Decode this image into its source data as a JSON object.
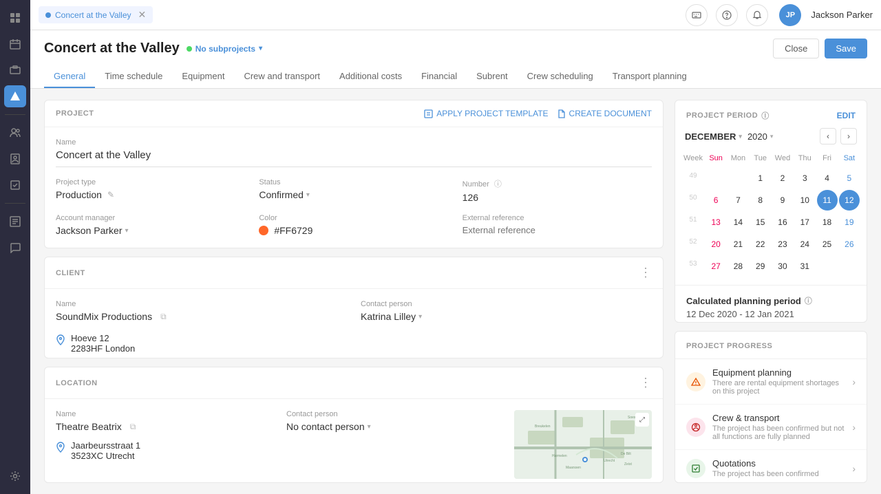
{
  "topbar": {
    "tab_title": "Concert at the Valley",
    "actions": [
      "help-keyboard",
      "help-circle",
      "bell"
    ],
    "avatar_initials": "JP",
    "username": "Jackson Parker"
  },
  "page": {
    "title": "Concert at the Valley",
    "subprojects_label": "No subprojects",
    "btn_close": "Close",
    "btn_save": "Save"
  },
  "tabs": [
    {
      "id": "general",
      "label": "General",
      "active": true
    },
    {
      "id": "time-schedule",
      "label": "Time schedule",
      "active": false
    },
    {
      "id": "equipment",
      "label": "Equipment",
      "active": false
    },
    {
      "id": "crew-transport",
      "label": "Crew and transport",
      "active": false
    },
    {
      "id": "additional-costs",
      "label": "Additional costs",
      "active": false
    },
    {
      "id": "financial",
      "label": "Financial",
      "active": false
    },
    {
      "id": "subrent",
      "label": "Subrent",
      "active": false
    },
    {
      "id": "crew-scheduling",
      "label": "Crew scheduling",
      "active": false
    },
    {
      "id": "transport-planning",
      "label": "Transport planning",
      "active": false
    }
  ],
  "project_card": {
    "section_title": "PROJECT",
    "apply_template_label": "APPLY PROJECT TEMPLATE",
    "create_doc_label": "CREATE DOCUMENT",
    "name_label": "Name",
    "name_value": "Concert at the Valley",
    "project_type_label": "Project type",
    "project_type_value": "Production",
    "status_label": "Status",
    "status_value": "Confirmed",
    "number_label": "Number",
    "number_value": "126",
    "account_manager_label": "Account manager",
    "account_manager_value": "Jackson Parker",
    "color_label": "Color",
    "color_value": "#FF6729",
    "external_ref_label": "External reference",
    "external_ref_placeholder": "External reference"
  },
  "client_card": {
    "section_title": "CLIENT",
    "name_label": "Name",
    "name_value": "SoundMix Productions",
    "contact_label": "Contact person",
    "contact_value": "Katrina Lilley",
    "address_line1": "Hoeve 12",
    "address_line2": "2283HF London"
  },
  "location_card": {
    "section_title": "LOCATION",
    "name_label": "Name",
    "name_value": "Theatre Beatrix",
    "contact_label": "Contact person",
    "contact_value": "No contact person",
    "address_line1": "Jaarbeursstraat 1",
    "address_line2": "3523XC Utrecht"
  },
  "project_period": {
    "section_title": "PROJECT PERIOD",
    "edit_label": "EDIT",
    "month": "DECEMBER",
    "year": "2020",
    "weekday_headers": [
      "Week",
      "Sun",
      "Mon",
      "Tue",
      "Wed",
      "Thu",
      "Fri",
      "Sat"
    ],
    "weeks": [
      {
        "week": "49",
        "days": [
          "",
          "",
          "1",
          "2",
          "3",
          "4",
          "5",
          ""
        ]
      },
      {
        "week": "50",
        "days": [
          "6",
          "7",
          "8",
          "9",
          "10",
          "11",
          "12",
          ""
        ]
      },
      {
        "week": "51",
        "days": [
          "13",
          "14",
          "15",
          "16",
          "17",
          "18",
          "19",
          ""
        ]
      },
      {
        "week": "52",
        "days": [
          "20",
          "21",
          "22",
          "23",
          "24",
          "25",
          "26",
          ""
        ]
      },
      {
        "week": "53",
        "days": [
          "27",
          "28",
          "29",
          "30",
          "31",
          "",
          "",
          ""
        ]
      }
    ],
    "today": "11",
    "selected": "12",
    "in_range_start": "12",
    "calculated_period_title": "Calculated planning period",
    "calculated_period_value": "12 Dec 2020 - 12 Jan 2021"
  },
  "project_progress": {
    "section_title": "PROJECT PROGRESS",
    "items": [
      {
        "id": "equipment-planning",
        "icon_type": "warning",
        "icon": "⚠",
        "title": "Equipment planning",
        "desc": "There are rental equipment shortages on this project"
      },
      {
        "id": "crew-transport",
        "icon_type": "error",
        "icon": "✗",
        "title": "Crew & transport",
        "desc": "The project has been confirmed but not all functions are fully planned"
      },
      {
        "id": "quotations",
        "icon_type": "success",
        "icon": "✓",
        "title": "Quotations",
        "desc": "The project has been confirmed"
      }
    ]
  },
  "sidebar": {
    "icons": [
      {
        "id": "grid",
        "symbol": "⊞",
        "active": false
      },
      {
        "id": "calendar",
        "symbol": "▦",
        "active": false
      },
      {
        "id": "box",
        "symbol": "◫",
        "active": false
      },
      {
        "id": "projects",
        "symbol": "◈",
        "active": true
      },
      {
        "id": "people",
        "symbol": "👤",
        "active": false
      },
      {
        "id": "contacts",
        "symbol": "◎",
        "active": false
      },
      {
        "id": "chat",
        "symbol": "⬚",
        "active": false
      },
      {
        "id": "reports",
        "symbol": "≡",
        "active": false
      },
      {
        "id": "tools",
        "symbol": "⚙",
        "active": false
      },
      {
        "id": "settings",
        "symbol": "◌",
        "active": false
      }
    ]
  }
}
